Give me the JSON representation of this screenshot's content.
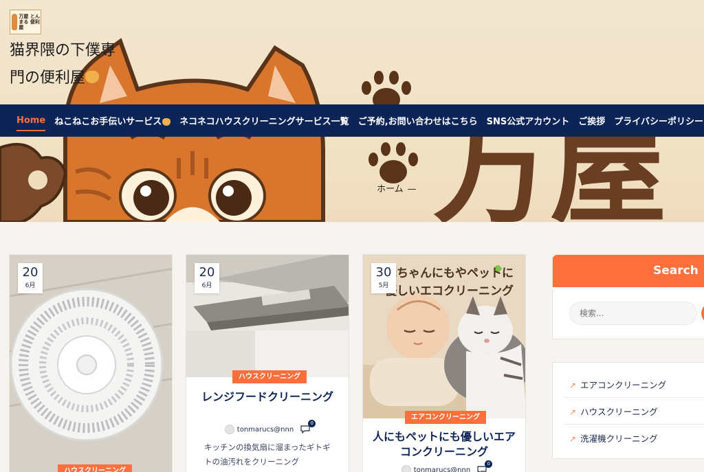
{
  "site": {
    "logo_text": "万屋 とんまる 便利屋",
    "title_line1": "猫界隈の下僕専",
    "title_line2": "門の便利屋"
  },
  "nav": {
    "items": [
      {
        "label": "Home",
        "active": true
      },
      {
        "label": "ねこねこお手伝いサービス",
        "active": false
      },
      {
        "label": "ネコネコハウスクリーニングサービス一覧",
        "active": false
      },
      {
        "label": "ご予約,お問い合わせはこちら",
        "active": false
      },
      {
        "label": "SNS公式アカウント",
        "active": false
      },
      {
        "label": "ご挨拶",
        "active": false
      },
      {
        "label": "プライバシーポリシー",
        "active": false
      }
    ]
  },
  "hero": {
    "banner_text": "万屋",
    "breadcrumb": {
      "home": "ホーム",
      "sep": "—"
    }
  },
  "posts": [
    {
      "day": "20",
      "month": "6月",
      "category": "ハウスクリーニング",
      "title": "",
      "author": "",
      "comments": "",
      "excerpt": ""
    },
    {
      "day": "20",
      "month": "6月",
      "category": "ハウスクリーニング",
      "title": "レンジフードクリーニング",
      "author": "tonmarucs@nnn",
      "comments": "0",
      "excerpt": "キッチンの換気扇に溜まったギトギトの油汚れをクリーニング"
    },
    {
      "day": "30",
      "month": "5月",
      "image_caption": "赤ちゃんにもやペットに優しいエコクリーニング",
      "category": "エアコンクリーニング",
      "title": "人にもペットにも優しいエアコンクリーニング",
      "author": "tonmarucs@nnn",
      "comments": "0",
      "excerpt": ""
    }
  ],
  "sidebar": {
    "search": {
      "title": "Search",
      "placeholder": "検索..."
    },
    "categories": [
      {
        "label": "エアコンクリーニング"
      },
      {
        "label": "ハウスクリーニング"
      },
      {
        "label": "洗濯機クリーニング"
      }
    ]
  },
  "colors": {
    "accent": "#ff6f3c",
    "navy": "#0d2456",
    "hero_bg": "#f2e3c8",
    "cat_orange": "#e08a3c"
  }
}
